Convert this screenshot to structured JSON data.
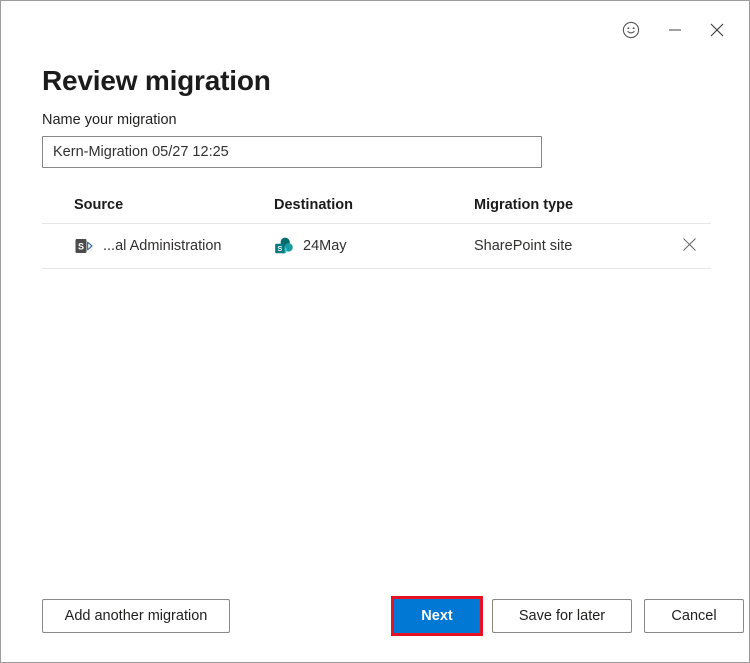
{
  "window": {
    "controls": {
      "feedback_icon": "smiley-face-icon",
      "minimize_icon": "minimize-icon",
      "close_icon": "close-icon"
    }
  },
  "page": {
    "title": "Review migration"
  },
  "form": {
    "name_label": "Name your migration",
    "name_value": "Kern-Migration 05/27 12:25",
    "name_placeholder": "Name your migration"
  },
  "table": {
    "columns": [
      "Source",
      "Destination",
      "Migration type"
    ],
    "rows": [
      {
        "source": "...al Administration",
        "source_icon": "sharepoint-server-icon",
        "destination": "24May",
        "destination_icon": "sharepoint-online-icon",
        "migration_type": "SharePoint site",
        "remove_icon": "close-icon"
      }
    ]
  },
  "footer": {
    "add_another_label": "Add another migration",
    "next_label": "Next",
    "save_for_later_label": "Save for later",
    "cancel_label": "Cancel"
  },
  "colors": {
    "accent_blue": "#0078d4",
    "highlight_red": "#e81123",
    "sharepoint_teal": "#038387",
    "sharepoint_server_gray": "#5a5a5a",
    "border_gray": "#8a8886",
    "divider_gray": "#e6e6e6"
  }
}
